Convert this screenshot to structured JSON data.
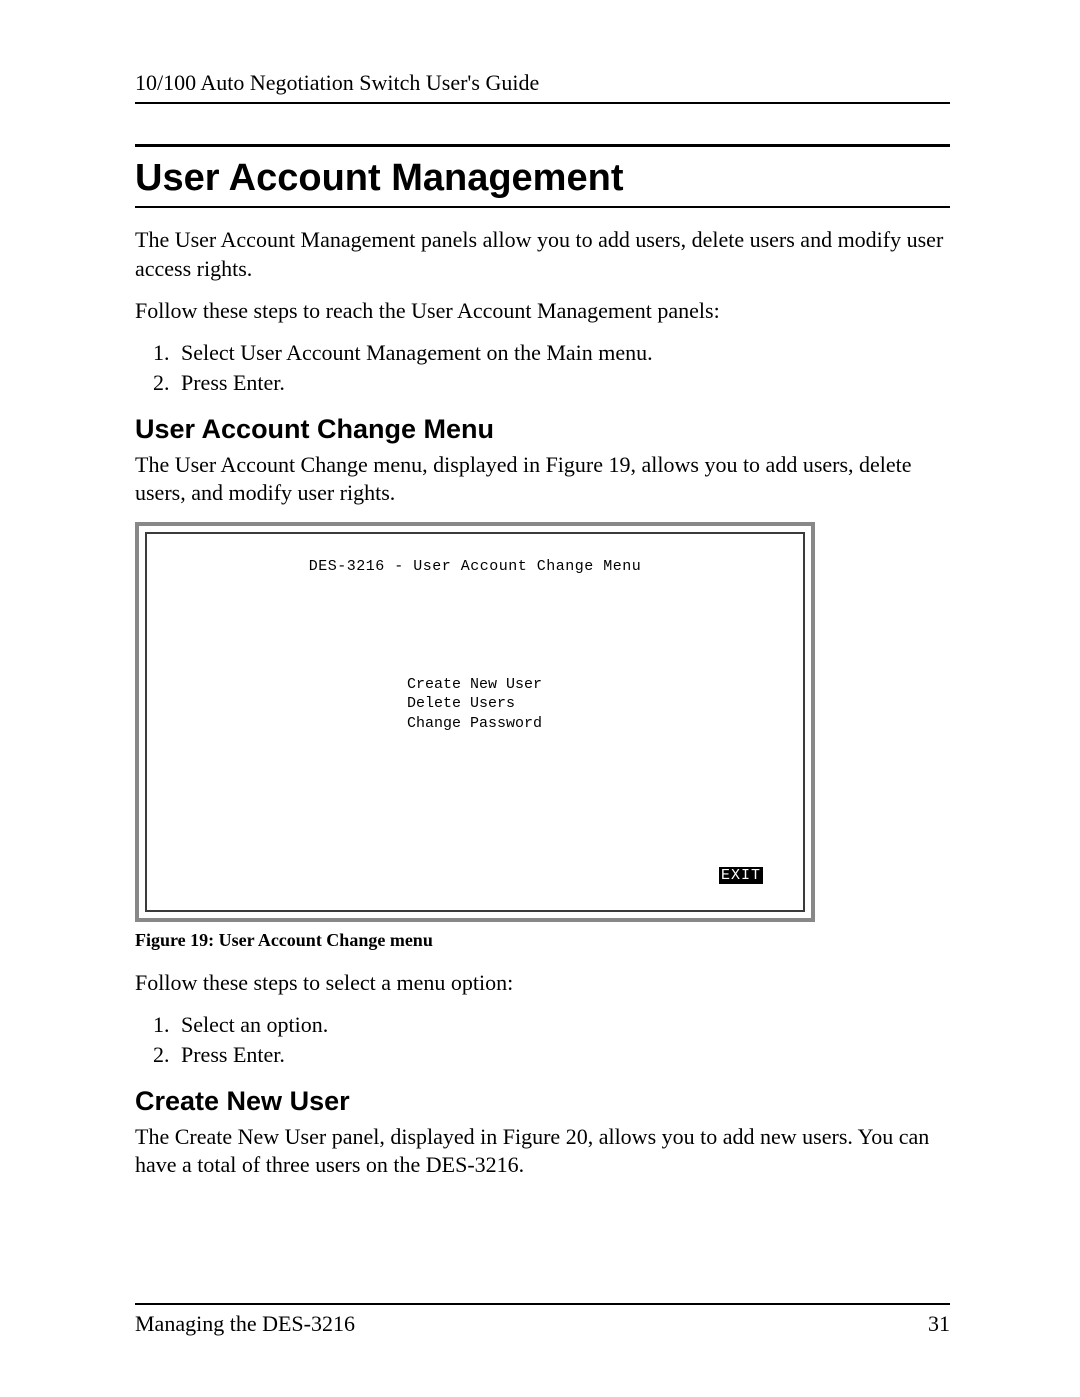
{
  "header": {
    "running_title": "10/100 Auto Negotiation Switch User's Guide"
  },
  "section": {
    "title": "User Account Management",
    "intro": "The User Account Management panels allow you to add users, delete users and modify user access rights.",
    "lead_in": "Follow these steps to reach the User Account Management panels:",
    "steps": [
      "Select User Account Management on the Main menu.",
      "Press Enter."
    ]
  },
  "sub1": {
    "title": "User Account Change Menu",
    "intro": "The User Account Change menu, displayed in Figure 19, allows you to add users, delete users, and modify user rights."
  },
  "terminal": {
    "title": "DES-3216 - User Account Change Menu",
    "items": [
      "Create New User",
      "Delete Users",
      "Change Password"
    ],
    "exit_label": "EXIT"
  },
  "figure_caption": "Figure 19: User Account Change menu",
  "post_fig": {
    "lead_in": "Follow these steps to select a menu option:",
    "steps": [
      "Select an option.",
      "Press Enter."
    ]
  },
  "sub2": {
    "title": "Create New User",
    "intro": "The Create New User panel, displayed in Figure 20, allows you to add new users. You can have a total of three users on the DES-3216."
  },
  "footer": {
    "left": "Managing the DES-3216",
    "page_number": "31"
  }
}
